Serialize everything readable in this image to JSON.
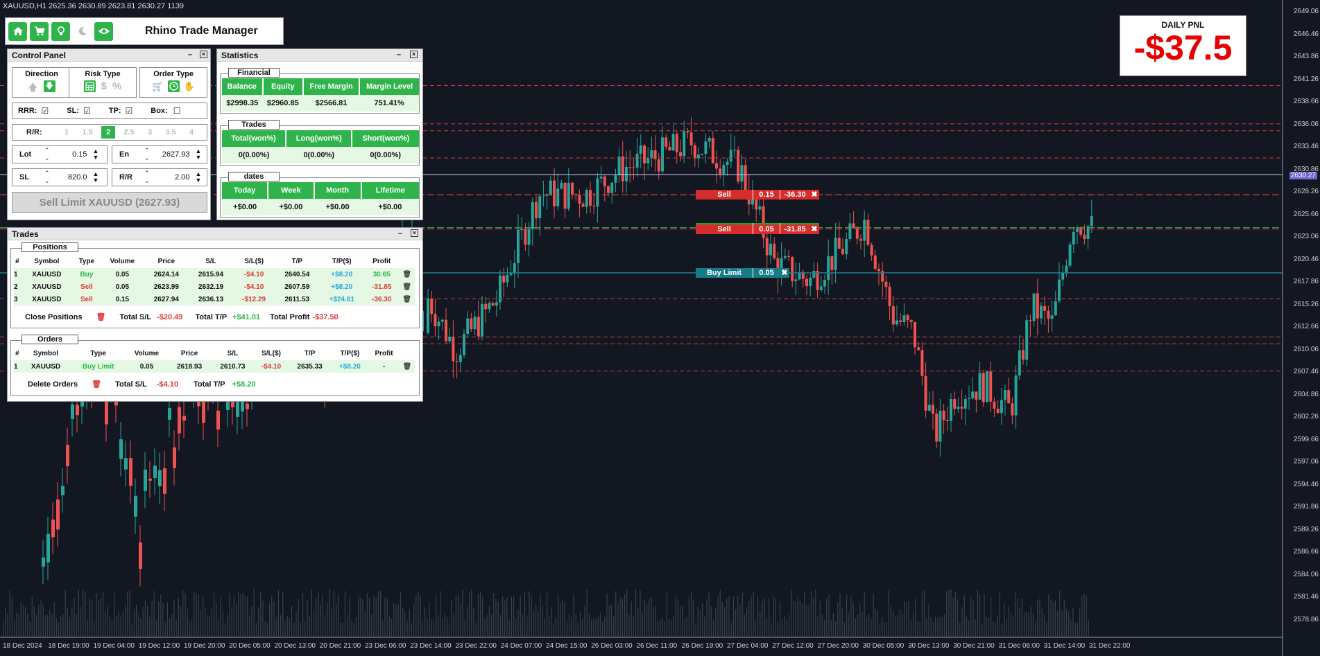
{
  "chart_info": "XAUUSD,H1  2625.36 2630.89 2623.81 2630.27  1139",
  "price_axis": [
    "2649.06",
    "2646.46",
    "2643.86",
    "2641.26",
    "2638.66",
    "2636.06",
    "2633.46",
    "2630.86",
    "2628.26",
    "2625.66",
    "2623.06",
    "2620.46",
    "2617.86",
    "2615.26",
    "2612.66",
    "2610.06",
    "2607.46",
    "2604.86",
    "2602.26",
    "2599.66",
    "2597.06",
    "2594.46",
    "2591.86",
    "2589.26",
    "2586.66",
    "2584.06",
    "2581.46",
    "2578.86"
  ],
  "current_price_tag": "2630.27",
  "time_axis": [
    "18 Dec 2024",
    "18 Dec 19:00",
    "19 Dec 04:00",
    "19 Dec 12:00",
    "19 Dec 20:00",
    "20 Dec 05:00",
    "20 Dec 13:00",
    "20 Dec 21:00",
    "23 Dec 06:00",
    "23 Dec 14:00",
    "23 Dec 22:00",
    "24 Dec 07:00",
    "24 Dec 15:00",
    "26 Dec 03:00",
    "26 Dec 11:00",
    "26 Dec 19:00",
    "27 Dec 04:00",
    "27 Dec 12:00",
    "27 Dec 20:00",
    "30 Dec 05:00",
    "30 Dec 13:00",
    "30 Dec 21:00",
    "31 Dec 06:00",
    "31 Dec 14:00",
    "31 Dec 22:00"
  ],
  "colors": {
    "bull": "#26a69a",
    "bear": "#ef5350",
    "accent": "#2fb44b",
    "pnl": "#e60000",
    "level_red": "#d63a3a",
    "level_teal": "#1f7e8c"
  },
  "toolbar": {
    "title": "Rhino Trade Manager",
    "icons": [
      "home-icon",
      "cart-icon",
      "lightbulb-icon",
      "moon-icon",
      "eye-icon"
    ]
  },
  "daily_pnl": {
    "title": "DAILY PNL",
    "value": "-$37.5"
  },
  "control_panel": {
    "title": "Control Panel",
    "direction_label": "Direction",
    "risk_type_label": "Risk Type",
    "order_type_label": "Order Type",
    "risk_symbols": [
      "$",
      "%"
    ],
    "rrr_label": "RRR:",
    "sl_label": "SL:",
    "tp_label": "TP:",
    "box_label": "Box:",
    "rr_label": "R/R:",
    "rr_options": [
      "1",
      "1.5",
      "2",
      "2.5",
      "3",
      "3.5",
      "4"
    ],
    "rr_selected": "2",
    "lot_label": "Lot",
    "lot_value": "0.15",
    "en_label": "En",
    "en_value": "2627.93",
    "sl_field_label": "SL",
    "sl_value": "820.0",
    "rr_field_label": "R/R",
    "rr_value": "2.00",
    "action_button": "Sell Limit XAUUSD (2627.93)"
  },
  "statistics": {
    "title": "Statistics",
    "financial": {
      "title": "Financial",
      "headers": [
        "Balance",
        "Equity",
        "Free Margin",
        "Margin Level"
      ],
      "values": [
        "$2998.35",
        "$2960.85",
        "$2566.81",
        "751.41%"
      ]
    },
    "trades": {
      "title": "Trades",
      "headers": [
        "Total(won%)",
        "Long(won%)",
        "Short(won%)"
      ],
      "values": [
        "0(0.00%)",
        "0(0.00%)",
        "0(0.00%)"
      ]
    },
    "dates": {
      "title": "dates",
      "headers": [
        "Today",
        "Week",
        "Month",
        "Lifetime"
      ],
      "values": [
        "+$0.00",
        "+$0.00",
        "+$0.00",
        "+$0.00"
      ]
    }
  },
  "trades_panel": {
    "title": "Trades",
    "positions_title": "Positions",
    "columns": [
      "#",
      "Symbol",
      "Type",
      "Volume",
      "Price",
      "S/L",
      "S/L($)",
      "T/P",
      "T/P($)",
      "Profit"
    ],
    "positions": [
      {
        "n": "1",
        "symbol": "XAUUSD",
        "type": "Buy",
        "volume": "0.05",
        "price": "2624.14",
        "sl": "2615.94",
        "sl_usd": "-$4.10",
        "tp": "2640.54",
        "tp_usd": "+$8.20",
        "profit": "30.65"
      },
      {
        "n": "2",
        "symbol": "XAUUSD",
        "type": "Sell",
        "volume": "0.05",
        "price": "2623.99",
        "sl": "2632.19",
        "sl_usd": "-$4.10",
        "tp": "2607.59",
        "tp_usd": "+$8.20",
        "profit": "-31.85"
      },
      {
        "n": "3",
        "symbol": "XAUUSD",
        "type": "Sell",
        "volume": "0.15",
        "price": "2627.94",
        "sl": "2636.13",
        "sl_usd": "-$12.29",
        "tp": "2611.53",
        "tp_usd": "+$24.61",
        "profit": "-36.30"
      }
    ],
    "close_positions_label": "Close Positions",
    "total_sl_label": "Total S/L",
    "total_sl": "-$20.49",
    "total_tp_label": "Total T/P",
    "total_tp": "+$41.01",
    "total_profit_label": "Total Profit",
    "total_profit": "-$37.50",
    "orders_title": "Orders",
    "orders": [
      {
        "n": "1",
        "symbol": "XAUUSD",
        "type": "Buy Limit",
        "volume": "0.05",
        "price": "2618.93",
        "sl": "2610.73",
        "sl_usd": "-$4.10",
        "tp": "2635.33",
        "tp_usd": "+$8.20",
        "profit": "-"
      }
    ],
    "delete_orders_label": "Delete Orders",
    "orders_total_sl": "-$4.10",
    "orders_total_tp": "+$8.20"
  },
  "chart_labels": [
    {
      "type": "Sell",
      "volume": "0.15",
      "pnl": "-36.30",
      "kind": "sell",
      "price": 2627.94
    },
    {
      "type": "Buy",
      "volume": "0.05",
      "pnl": "30.65",
      "kind": "buy",
      "price": 2624.14
    },
    {
      "type": "Sell",
      "volume": "0.05",
      "pnl": "-31.85",
      "kind": "sell",
      "price": 2623.99
    },
    {
      "type": "Buy Limit",
      "volume": "0.05",
      "pnl": "",
      "kind": "limit",
      "price": 2618.93
    }
  ],
  "levels": [
    2640.54,
    2636.13,
    2635.33,
    2632.19,
    2615.94,
    2611.53,
    2610.73,
    2607.59
  ]
}
